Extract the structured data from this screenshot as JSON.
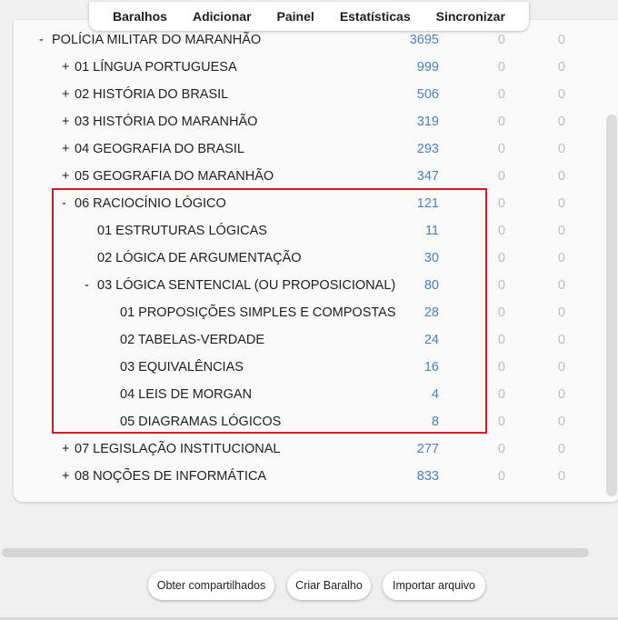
{
  "toolbar": {
    "decks": "Baralhos",
    "add": "Adicionar",
    "dashboard": "Painel",
    "stats": "Estatísticas",
    "sync": "Sincronizar"
  },
  "decks": [
    {
      "toggle": "-",
      "name": "POLÍCIA MILITAR DO MARANHÃO",
      "c1": "3695",
      "c2": "0",
      "c3": "0",
      "indent": 0
    },
    {
      "toggle": "+",
      "name": "01 LÍNGUA PORTUGUESA",
      "c1": "999",
      "c2": "0",
      "c3": "0",
      "indent": 1
    },
    {
      "toggle": "+",
      "name": "02 HISTÓRIA DO BRASIL",
      "c1": "506",
      "c2": "0",
      "c3": "0",
      "indent": 1
    },
    {
      "toggle": "+",
      "name": "03 HISTÓRIA DO MARANHÃO",
      "c1": "319",
      "c2": "0",
      "c3": "0",
      "indent": 1
    },
    {
      "toggle": "+",
      "name": "04 GEOGRAFIA DO BRASIL",
      "c1": "293",
      "c2": "0",
      "c3": "0",
      "indent": 1
    },
    {
      "toggle": "+",
      "name": "05 GEOGRAFIA DO MARANHÃO",
      "c1": "347",
      "c2": "0",
      "c3": "0",
      "indent": 1
    },
    {
      "toggle": "-",
      "name": "06 RACIOCÍNIO LÓGICO",
      "c1": "121",
      "c2": "0",
      "c3": "0",
      "indent": 1
    },
    {
      "toggle": "",
      "name": "01 ESTRUTURAS LÓGICAS",
      "c1": "11",
      "c2": "0",
      "c3": "0",
      "indent": 2
    },
    {
      "toggle": "",
      "name": "02 LÓGICA DE ARGUMENTAÇÃO",
      "c1": "30",
      "c2": "0",
      "c3": "0",
      "indent": 2
    },
    {
      "toggle": "-",
      "name": "03 LÓGICA SENTENCIAL (OU PROPOSICIONAL)",
      "c1": "80",
      "c2": "0",
      "c3": "0",
      "indent": 2
    },
    {
      "toggle": "",
      "name": "01 PROPOSIÇÕES SIMPLES E COMPOSTAS",
      "c1": "28",
      "c2": "0",
      "c3": "0",
      "indent": 3
    },
    {
      "toggle": "",
      "name": "02 TABELAS-VERDADE",
      "c1": "24",
      "c2": "0",
      "c3": "0",
      "indent": 3
    },
    {
      "toggle": "",
      "name": "03 EQUIVALÊNCIAS",
      "c1": "16",
      "c2": "0",
      "c3": "0",
      "indent": 3
    },
    {
      "toggle": "",
      "name": "04 LEIS DE MORGAN",
      "c1": "4",
      "c2": "0",
      "c3": "0",
      "indent": 3
    },
    {
      "toggle": "",
      "name": "05 DIAGRAMAS LÓGICOS",
      "c1": "8",
      "c2": "0",
      "c3": "0",
      "indent": 3
    },
    {
      "toggle": "+",
      "name": "07 LEGISLAÇÃO INSTITUCIONAL",
      "c1": "277",
      "c2": "0",
      "c3": "0",
      "indent": 1
    },
    {
      "toggle": "+",
      "name": "08 NOÇÕES DE INFORMÁTICA",
      "c1": "833",
      "c2": "0",
      "c3": "0",
      "indent": 1
    }
  ],
  "buttons": {
    "shared": "Obter compartilhados",
    "create": "Criar Baralho",
    "import": "Importar arquivo"
  },
  "colors": {
    "due_count": "#4a7fc9",
    "zero_count": "#bdbdbd",
    "highlight_box": "#d6171e"
  }
}
